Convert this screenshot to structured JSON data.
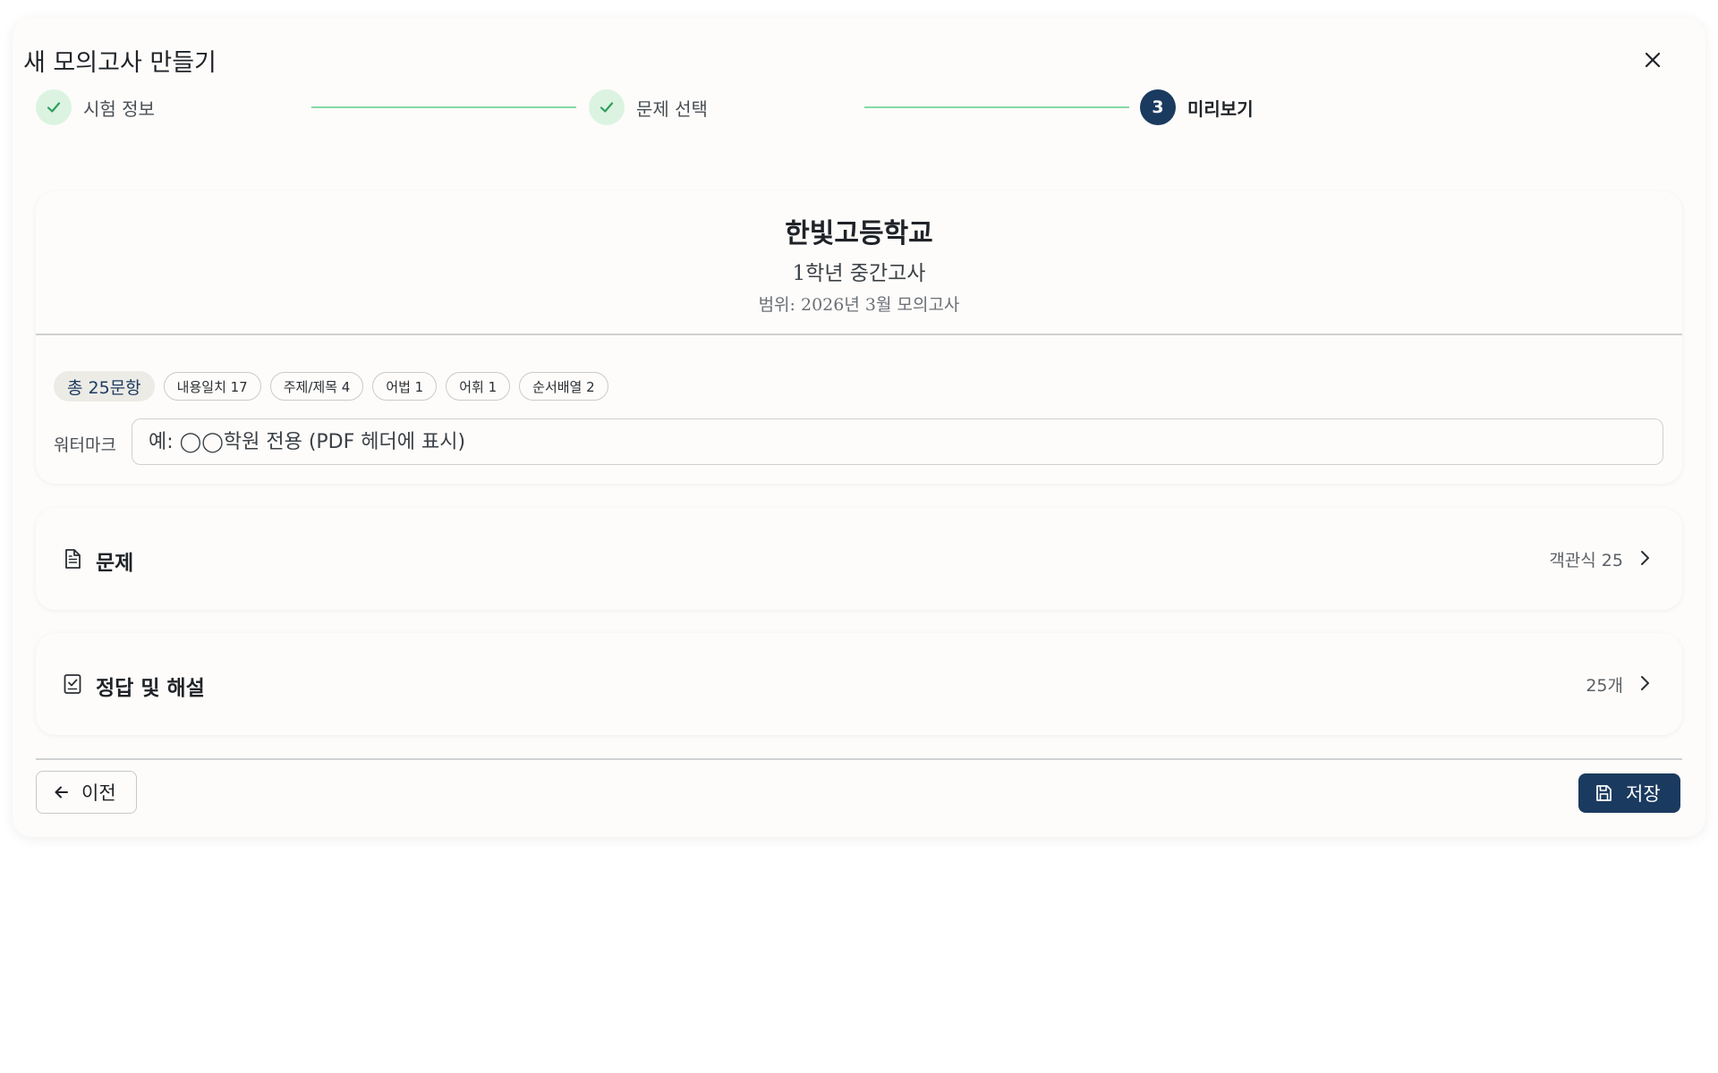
{
  "modal": {
    "title": "새 모의고사 만들기",
    "close_icon": "close-icon"
  },
  "stepper": {
    "steps": [
      {
        "label": "시험 정보",
        "state": "done"
      },
      {
        "label": "문제 선택",
        "state": "done"
      },
      {
        "label": "미리보기",
        "state": "active",
        "number": "3"
      }
    ],
    "colors": {
      "done_bg": "#dcf3e2",
      "check": "#2f9e5b",
      "line": "#86d9a4",
      "active_bg": "#1b3a5f"
    }
  },
  "preview": {
    "school": "한빛고등학교",
    "exam_name": "1학년 중간고사",
    "range_label": "범위:",
    "range_value": "2026년 3월 모의고사",
    "chips": {
      "total": "총 25문항",
      "items": [
        "내용일치 17",
        "주제/제목 4",
        "어법 1",
        "어휘 1",
        "순서배열 2"
      ]
    },
    "watermark": {
      "label": "워터마크",
      "placeholder": "예: ◯◯학원 전용 (PDF 헤더에 표시)"
    }
  },
  "sections": {
    "questions": {
      "title": "문제",
      "meta": "객관식 25",
      "icon": "document-icon"
    },
    "answers": {
      "title": "정답 및 해설",
      "meta": "25개",
      "icon": "checklist-icon"
    }
  },
  "footer": {
    "prev_label": "이전",
    "save_label": "저장",
    "accent": "#1b3a5f"
  }
}
